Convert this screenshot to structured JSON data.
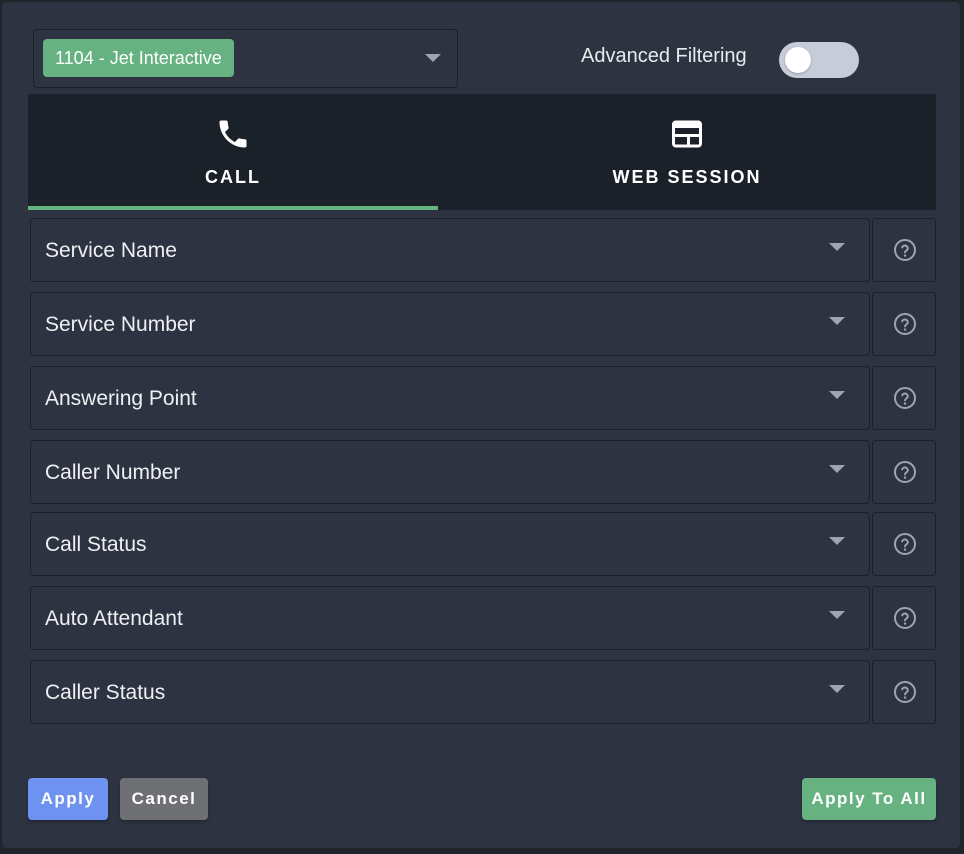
{
  "account": {
    "selected_label": "1104 - Jet Interactive"
  },
  "advanced_filtering": {
    "label": "Advanced Filtering",
    "enabled": false
  },
  "tabs": [
    {
      "label": "CALL",
      "icon": "phone-icon",
      "active": true
    },
    {
      "label": "WEB SESSION",
      "icon": "browser-window-icon",
      "active": false
    }
  ],
  "filters": [
    {
      "label": "Service Name"
    },
    {
      "label": "Service Number"
    },
    {
      "label": "Answering Point"
    },
    {
      "label": "Caller Number"
    },
    {
      "label": "Call Status"
    },
    {
      "label": "Auto Attendant"
    },
    {
      "label": "Caller Status"
    }
  ],
  "buttons": {
    "apply": "Apply",
    "cancel": "Cancel",
    "apply_all": "Apply To All"
  },
  "colors": {
    "accent_green": "#66b381",
    "apply_blue": "#6d92f0",
    "cancel_gray": "#6f7073",
    "panel_bg": "#2d3341",
    "tab_bg": "#1b2129"
  }
}
